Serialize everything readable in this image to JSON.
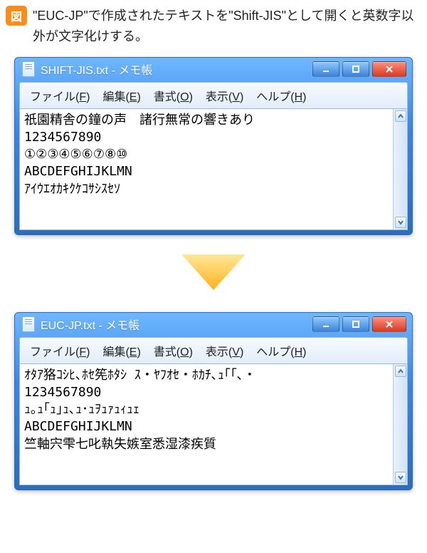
{
  "caption": {
    "badge": "図",
    "text": "\"EUC-JP\"で作成されたテキストを\"Shift-JIS\"として開くと英数字以外が文字化けする。"
  },
  "menu": {
    "file": "ファイル(",
    "file_k": "F",
    "edit": "編集(",
    "edit_k": "E",
    "format": "書式(",
    "format_k": "O",
    "view": "表示(",
    "view_k": "V",
    "help": "ヘルプ(",
    "help_k": "H",
    "close_paren": ")"
  },
  "window1": {
    "title": "SHIFT-JIS.txt - メモ帳",
    "lines": [
      "祇園精舎の鐘の声　諸行無常の響きあり",
      "1234567890",
      "①②③④⑤⑥⑦⑧⑩",
      "ABCDEFGHIJKLMN",
      "ｱｲｳｴｵｶｷｸｹｺｻｼｽｾｿ"
    ]
  },
  "window2": {
    "title": "EUC-JP.txt - メモ帳",
    "lines": [
      "ｵﾀｱ狢ｺｼﾋ､ﾎｾ筅ﾎﾀｼ ｽ・ﾔﾌｵｾ・ﾎｶﾁ､ｭ｢｢､・",
      "1234567890",
      "ｭ｡ｭ｢ｭ｣ｭ､ｭ･ｭｦｭｧｭｨｭｪ",
      "ABCDEFGHIJKLMN",
      "竺軸宍雫七叱執失嫉室悉湿漆疾質"
    ]
  }
}
